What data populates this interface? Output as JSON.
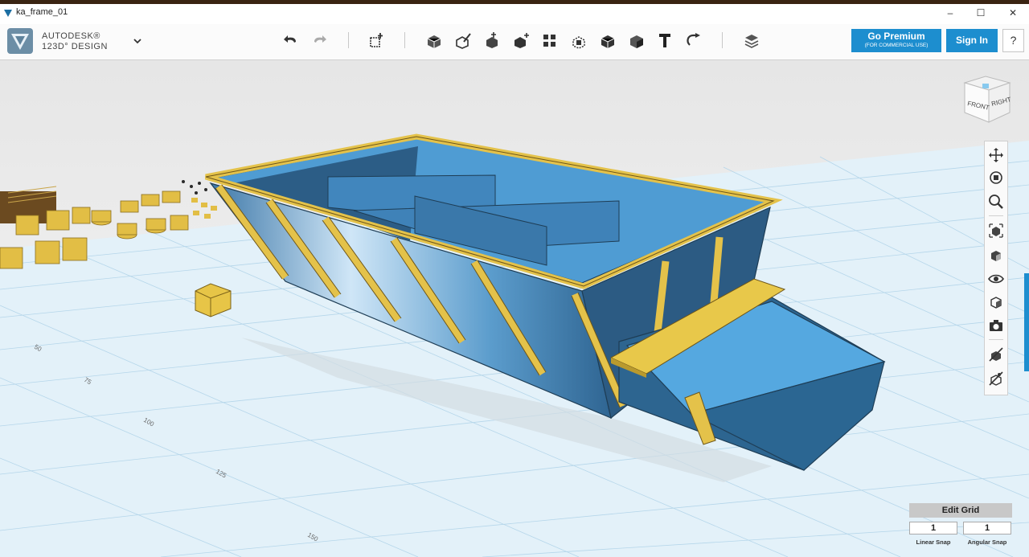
{
  "window": {
    "title": "ka_frame_01",
    "minimize": "–",
    "maximize": "☐",
    "close": "✕"
  },
  "brand": {
    "line1": "AUTODESK®",
    "line2": "123D° DESIGN"
  },
  "toolbar": {
    "icons": [
      "undo-icon",
      "redo-icon",
      "primitives-icon",
      "sketch-icon",
      "construct-icon",
      "modify-icon",
      "pattern-icon",
      "group-icon",
      "combine-icon",
      "measure-icon",
      "text-icon",
      "snap-icon",
      "material-icon"
    ]
  },
  "actions": {
    "premium": "Go Premium",
    "premium_sub": "(FOR COMMERCIAL USE)",
    "signin": "Sign In",
    "help": "?"
  },
  "viewcube": {
    "front": "FRONT",
    "right": "RIGHT"
  },
  "nav_tools": [
    "pan",
    "orbit",
    "zoom",
    "fit",
    "view-selected",
    "visibility",
    "materials-outlines",
    "screenshot",
    "show-hide",
    "physical-material"
  ],
  "grid_labels": [
    "50",
    "75",
    "100",
    "125",
    "150"
  ],
  "grid": {
    "edit_label": "Edit Grid",
    "linear_snap": "1",
    "angular_snap": "1",
    "linear_label": "Linear Snap",
    "angular_label": "Angular Snap"
  },
  "colors": {
    "accent": "#1d8ecf",
    "wood": "#e5c347",
    "box": "#4e94c9",
    "grid": "#cce3f0"
  }
}
